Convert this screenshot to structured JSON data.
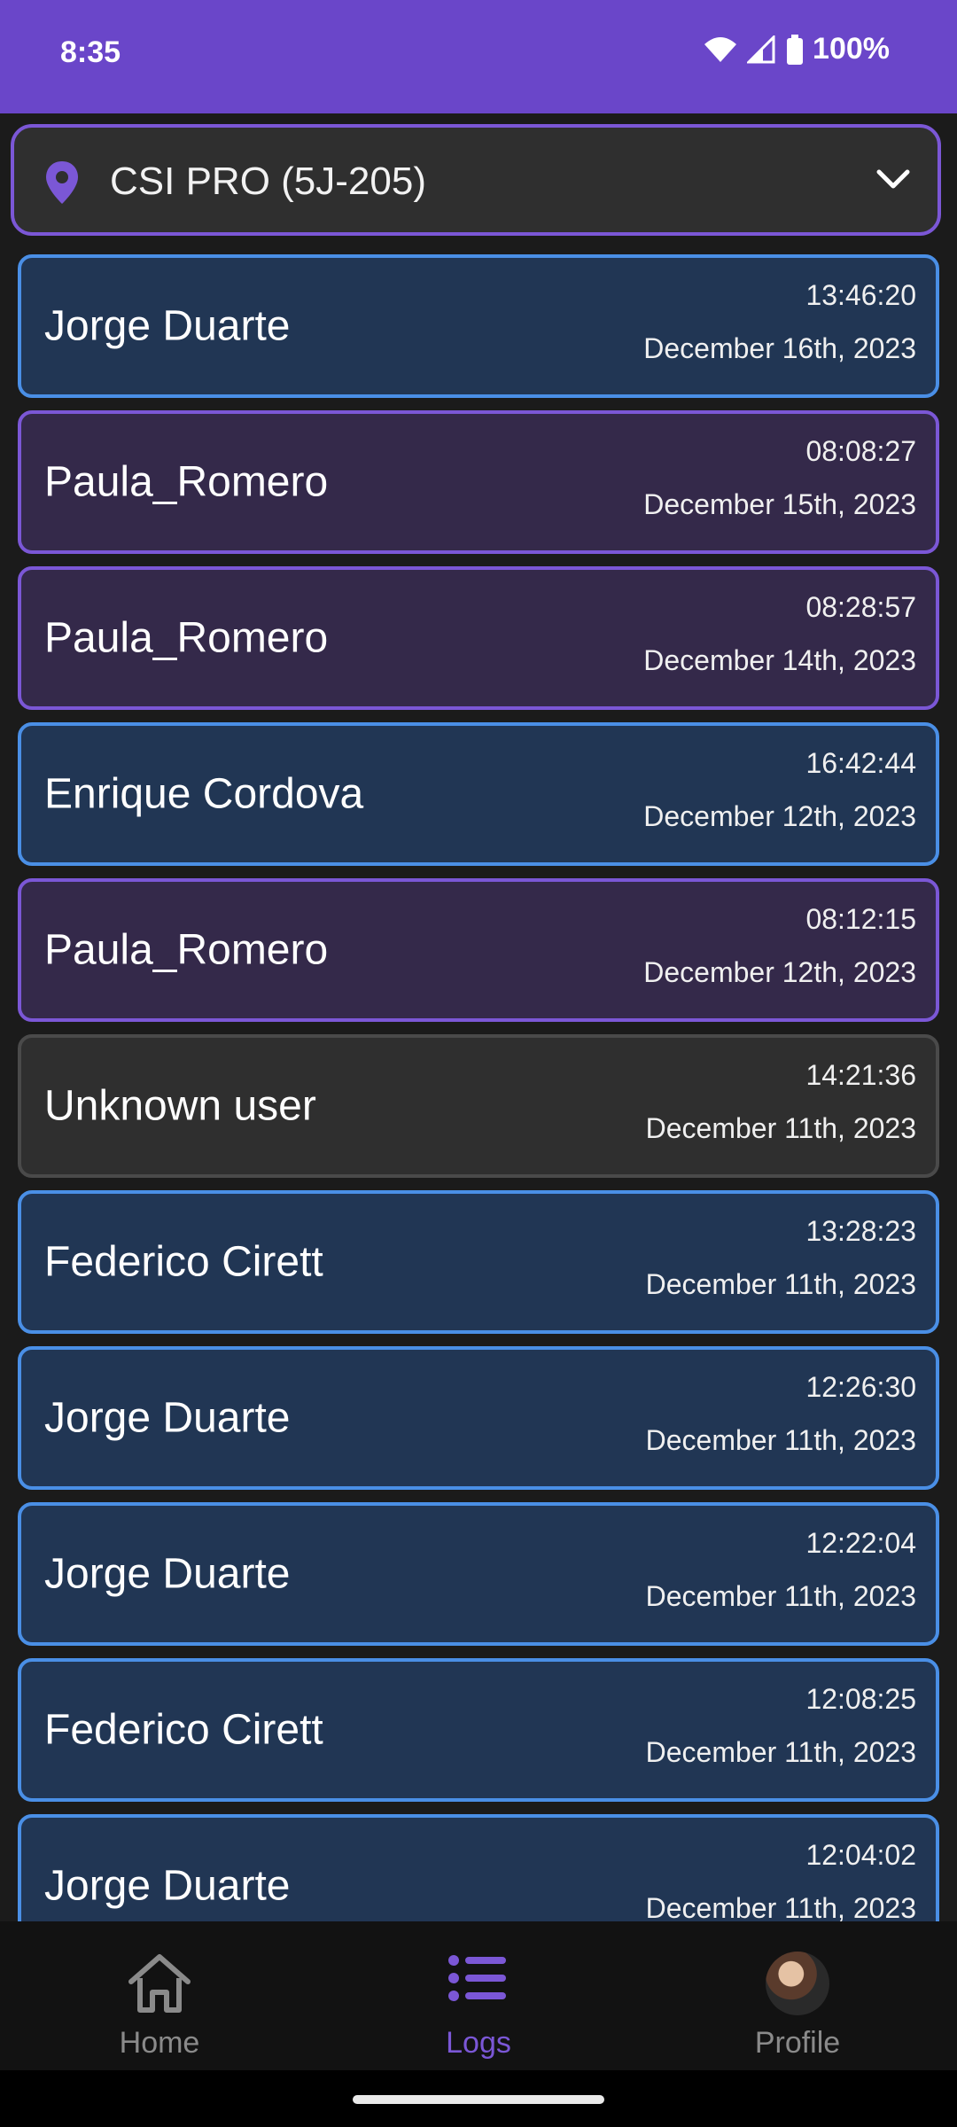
{
  "status_bar": {
    "time": "8:35",
    "battery": "100%"
  },
  "location_selector": {
    "label": "CSI PRO (5J-205)"
  },
  "logs": [
    {
      "name": "Jorge Duarte",
      "time": "13:46:20",
      "date": "December 16th, 2023",
      "kind": "blue"
    },
    {
      "name": "Paula_Romero",
      "time": "08:08:27",
      "date": "December 15th, 2023",
      "kind": "purple"
    },
    {
      "name": "Paula_Romero",
      "time": "08:28:57",
      "date": "December 14th, 2023",
      "kind": "purple"
    },
    {
      "name": "Enrique Cordova",
      "time": "16:42:44",
      "date": "December 12th, 2023",
      "kind": "blue"
    },
    {
      "name": "Paula_Romero",
      "time": "08:12:15",
      "date": "December 12th, 2023",
      "kind": "purple"
    },
    {
      "name": "Unknown user",
      "time": "14:21:36",
      "date": "December 11th, 2023",
      "kind": "gray"
    },
    {
      "name": "Federico Cirett",
      "time": "13:28:23",
      "date": "December 11th, 2023",
      "kind": "blue"
    },
    {
      "name": "Jorge Duarte",
      "time": "12:26:30",
      "date": "December 11th, 2023",
      "kind": "blue"
    },
    {
      "name": "Jorge Duarte",
      "time": "12:22:04",
      "date": "December 11th, 2023",
      "kind": "blue"
    },
    {
      "name": "Federico Cirett",
      "time": "12:08:25",
      "date": "December 11th, 2023",
      "kind": "blue"
    },
    {
      "name": "Jorge Duarte",
      "time": "12:04:02",
      "date": "December 11th, 2023",
      "kind": "blue"
    }
  ],
  "card_colors": {
    "blue": {
      "bg": "#213654",
      "border": "#4a8fe6"
    },
    "purple": {
      "bg": "#34294a",
      "border": "#7b57d6"
    },
    "gray": {
      "bg": "#2f2f2f",
      "border": "#4a4a4a"
    }
  },
  "bottom_nav": {
    "home": {
      "label": "Home",
      "icon": "home-icon"
    },
    "logs": {
      "label": "Logs",
      "icon": "list-icon"
    },
    "profile": {
      "label": "Profile",
      "icon": "avatar"
    }
  },
  "colors": {
    "accent": "#7b57d6",
    "status_bar": "#6a46c9"
  }
}
